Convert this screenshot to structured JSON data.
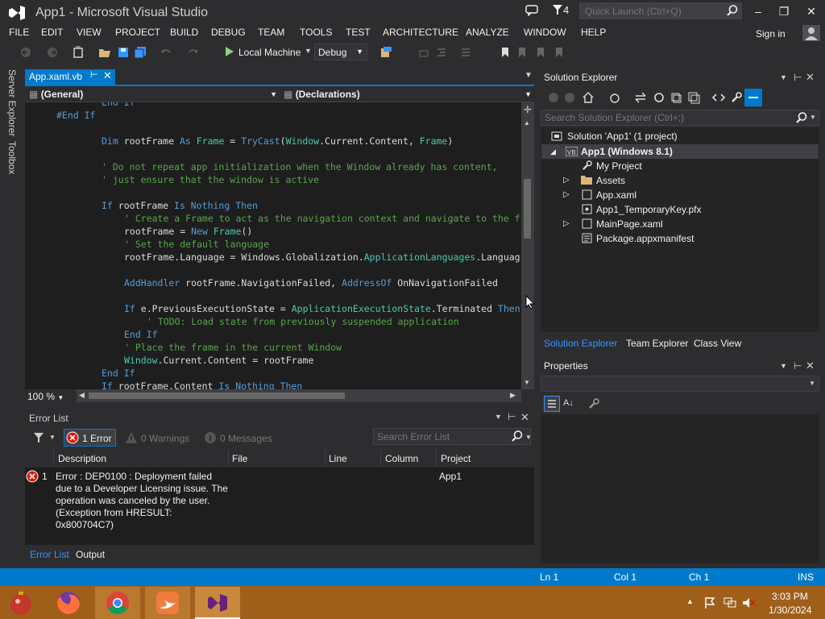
{
  "window": {
    "title": "App1 - Microsoft Visual Studio",
    "filter_count": "4",
    "quick_launch_placeholder": "Quick Launch (Ctrl+Q)",
    "sign_in": "Sign in"
  },
  "menu": [
    "FILE",
    "EDIT",
    "VIEW",
    "PROJECT",
    "BUILD",
    "DEBUG",
    "TEAM",
    "TOOLS",
    "TEST",
    "ARCHITECTURE",
    "ANALYZE",
    "WINDOW",
    "HELP"
  ],
  "toolbar": {
    "run_target": "Local Machine",
    "configuration": "Debug"
  },
  "side_tabs": [
    "Server Explorer",
    "Toolbox"
  ],
  "editor": {
    "tab": "App.xaml.vb",
    "nav_left": "(General)",
    "nav_right": "(Declarations)",
    "zoom": "100 %",
    "code_lines": [
      {
        "indent": 8,
        "tokens": [
          {
            "t": "End If",
            "c": "kw"
          }
        ]
      },
      {
        "indent": 0,
        "tokens": [
          {
            "t": "#End If",
            "c": "kw"
          }
        ]
      },
      {
        "indent": 0,
        "tokens": []
      },
      {
        "indent": 8,
        "tokens": [
          {
            "t": "Dim",
            "c": "kw"
          },
          {
            "t": " rootFrame ",
            "c": ""
          },
          {
            "t": "As",
            "c": "kw"
          },
          {
            "t": " ",
            "c": ""
          },
          {
            "t": "Frame",
            "c": "ty"
          },
          {
            "t": " = ",
            "c": ""
          },
          {
            "t": "TryCast",
            "c": "kw"
          },
          {
            "t": "(",
            "c": ""
          },
          {
            "t": "Window",
            "c": "ty"
          },
          {
            "t": ".Current.Content, ",
            "c": ""
          },
          {
            "t": "Frame",
            "c": "ty"
          },
          {
            "t": ")",
            "c": ""
          }
        ]
      },
      {
        "indent": 0,
        "tokens": []
      },
      {
        "indent": 8,
        "tokens": [
          {
            "t": "' Do not repeat app initialization when the Window already has content,",
            "c": "cm"
          }
        ]
      },
      {
        "indent": 8,
        "tokens": [
          {
            "t": "' just ensure that the window is active",
            "c": "cm"
          }
        ]
      },
      {
        "indent": 0,
        "tokens": []
      },
      {
        "indent": 8,
        "tokens": [
          {
            "t": "If",
            "c": "kw"
          },
          {
            "t": " rootFrame ",
            "c": ""
          },
          {
            "t": "Is Nothing Then",
            "c": "kw"
          }
        ]
      },
      {
        "indent": 12,
        "tokens": [
          {
            "t": "' Create a Frame to act as the navigation context and navigate to the fi",
            "c": "cm"
          }
        ]
      },
      {
        "indent": 12,
        "tokens": [
          {
            "t": "rootFrame = ",
            "c": ""
          },
          {
            "t": "New",
            "c": "kw"
          },
          {
            "t": " ",
            "c": ""
          },
          {
            "t": "Frame",
            "c": "ty"
          },
          {
            "t": "()",
            "c": ""
          }
        ]
      },
      {
        "indent": 12,
        "tokens": [
          {
            "t": "' Set the default language",
            "c": "cm"
          }
        ]
      },
      {
        "indent": 12,
        "tokens": [
          {
            "t": "rootFrame.Language = Windows.Globalization.",
            "c": ""
          },
          {
            "t": "ApplicationLanguages",
            "c": "ty"
          },
          {
            "t": ".Languag",
            "c": ""
          }
        ]
      },
      {
        "indent": 0,
        "tokens": []
      },
      {
        "indent": 12,
        "tokens": [
          {
            "t": "AddHandler",
            "c": "kw"
          },
          {
            "t": " rootFrame.NavigationFailed, ",
            "c": ""
          },
          {
            "t": "AddressOf",
            "c": "kw"
          },
          {
            "t": " OnNavigationFailed",
            "c": ""
          }
        ]
      },
      {
        "indent": 0,
        "tokens": []
      },
      {
        "indent": 12,
        "tokens": [
          {
            "t": "If",
            "c": "kw"
          },
          {
            "t": " e.PreviousExecutionState = ",
            "c": ""
          },
          {
            "t": "ApplicationExecutionState",
            "c": "ty"
          },
          {
            "t": ".Terminated ",
            "c": ""
          },
          {
            "t": "Then",
            "c": "kw"
          }
        ]
      },
      {
        "indent": 16,
        "tokens": [
          {
            "t": "' TODO: Load state from previously suspended application",
            "c": "cm"
          }
        ]
      },
      {
        "indent": 12,
        "tokens": [
          {
            "t": "End If",
            "c": "kw"
          }
        ]
      },
      {
        "indent": 12,
        "tokens": [
          {
            "t": "' Place the frame in the current Window",
            "c": "cm"
          }
        ]
      },
      {
        "indent": 12,
        "tokens": [
          {
            "t": "Window",
            "c": "ty"
          },
          {
            "t": ".Current.Content = rootFrame",
            "c": ""
          }
        ]
      },
      {
        "indent": 8,
        "tokens": [
          {
            "t": "End If",
            "c": "kw"
          }
        ]
      },
      {
        "indent": 8,
        "tokens": [
          {
            "t": "If",
            "c": "kw"
          },
          {
            "t": " rootFrame.Content ",
            "c": ""
          },
          {
            "t": "Is Nothing Then",
            "c": "kw"
          }
        ]
      }
    ]
  },
  "error_list": {
    "title": "Error List",
    "errors_btn": "1 Error",
    "warnings_btn": "0 Warnings",
    "messages_btn": "0 Messages",
    "search_placeholder": "Search Error List",
    "columns": [
      "Description",
      "File",
      "Line",
      "Column",
      "Project"
    ],
    "rows": [
      {
        "num": "1",
        "description": "Error : DEP0100 : Deployment failed due to a Developer Licensing issue. The operation was canceled by the user. (Exception from HRESULT: 0x800704C7)",
        "file": "",
        "line": "",
        "column": "",
        "project": "App1"
      }
    ],
    "bottom_tabs": [
      "Error List",
      "Output"
    ]
  },
  "solution_explorer": {
    "title": "Solution Explorer",
    "search_placeholder": "Search Solution Explorer (Ctrl+;)",
    "solution": "Solution 'App1' (1 project)",
    "project": "App1 (Windows 8.1)",
    "items": [
      "My Project",
      "Assets",
      "App.xaml",
      "App1_TemporaryKey.pfx",
      "MainPage.xaml",
      "Package.appxmanifest"
    ],
    "tabs": [
      "Solution Explorer",
      "Team Explorer",
      "Class View"
    ]
  },
  "properties": {
    "title": "Properties"
  },
  "status": {
    "ln": "Ln 1",
    "col": "Col 1",
    "ch": "Ch 1",
    "ins": "INS"
  },
  "clock": {
    "time": "3:03 PM",
    "date": "1/30/2024"
  },
  "colors": {
    "accent": "#007acc",
    "taskbar": "#9f5f1a",
    "error": "#e51400"
  }
}
